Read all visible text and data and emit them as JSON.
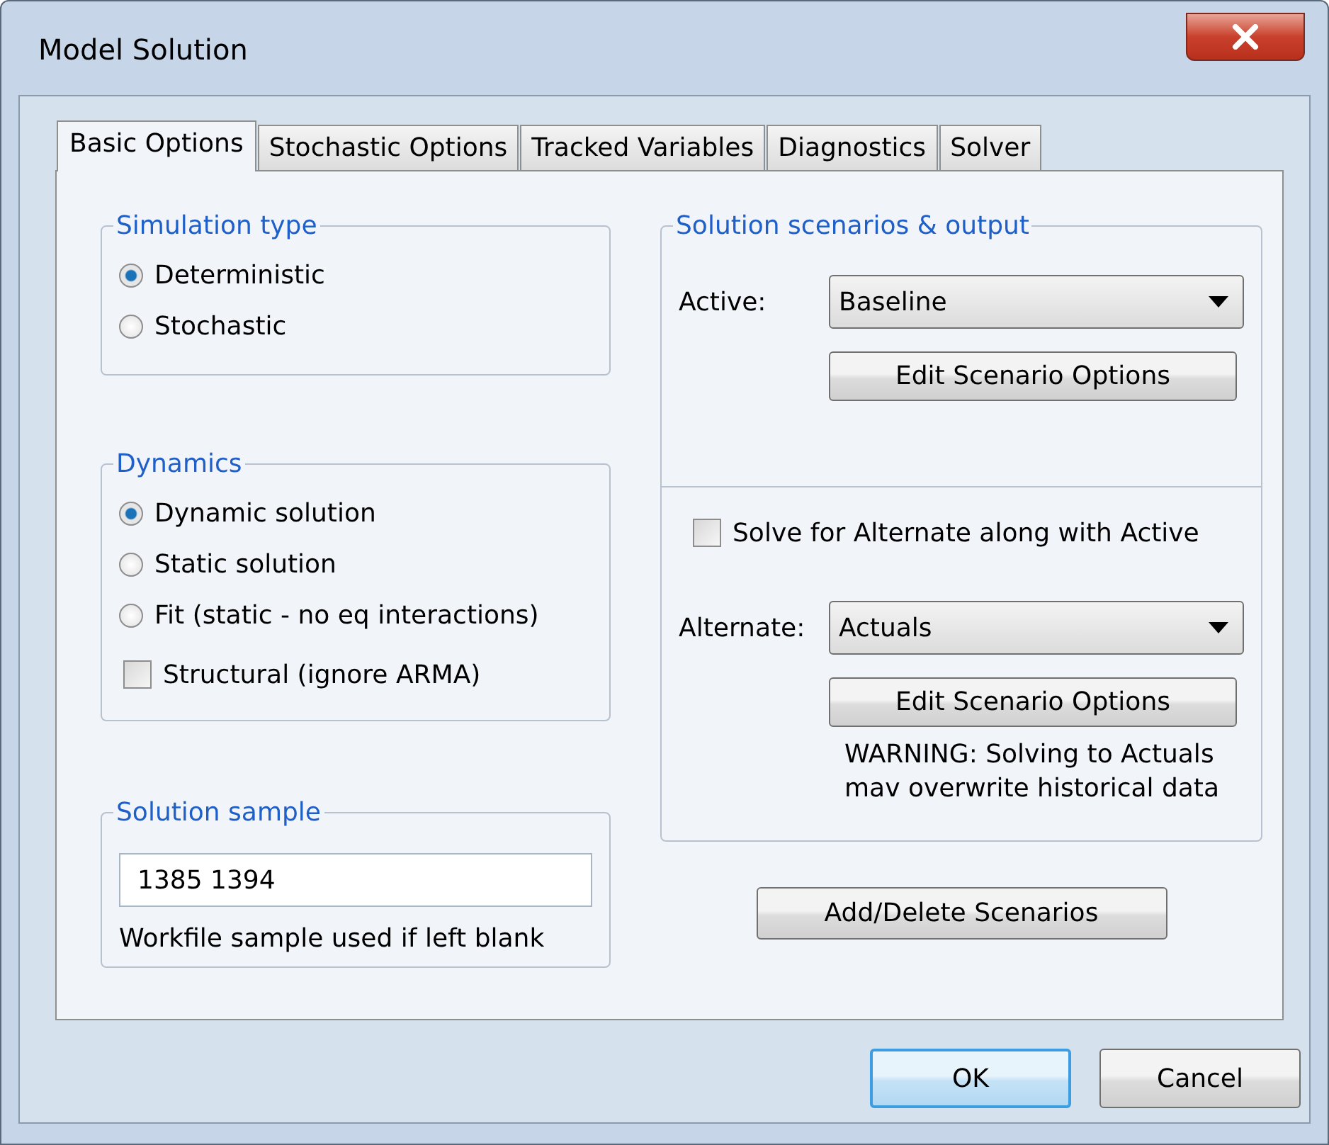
{
  "window": {
    "title": "Model Solution"
  },
  "tabs": [
    {
      "label": "Basic Options",
      "selected": true
    },
    {
      "label": "Stochastic Options",
      "selected": false
    },
    {
      "label": "Tracked Variables",
      "selected": false
    },
    {
      "label": "Diagnostics",
      "selected": false
    },
    {
      "label": "Solver",
      "selected": false
    }
  ],
  "simulation_type": {
    "title": "Simulation type",
    "options": [
      {
        "label": "Deterministic",
        "selected": true
      },
      {
        "label": "Stochastic",
        "selected": false
      }
    ]
  },
  "dynamics": {
    "title": "Dynamics",
    "options": [
      {
        "label": "Dynamic solution",
        "selected": true
      },
      {
        "label": "Static solution",
        "selected": false
      },
      {
        "label": "Fit (static - no eq interactions)",
        "selected": false
      }
    ],
    "checkbox": {
      "label": "Structural (ignore ARMA)",
      "checked": false
    }
  },
  "solution_sample": {
    "title": "Solution sample",
    "value": "1385 1394",
    "note": "Workfile sample used if left blank"
  },
  "scenarios": {
    "title": "Solution scenarios & output",
    "active": {
      "label": "Active:",
      "value": "Baseline",
      "button": "Edit Scenario Options"
    },
    "solve_alternate": {
      "label": "Solve for Alternate along with Active",
      "checked": false
    },
    "alternate": {
      "label": "Alternate:",
      "value": "Actuals",
      "button": "Edit Scenario Options"
    },
    "warning": [
      "WARNING: Solving to Actuals",
      "mav overwrite historical data"
    ]
  },
  "add_delete_button": "Add/Delete Scenarios",
  "buttons": [
    {
      "label": "OK",
      "default": true
    },
    {
      "label": "Cancel",
      "default": false
    }
  ]
}
